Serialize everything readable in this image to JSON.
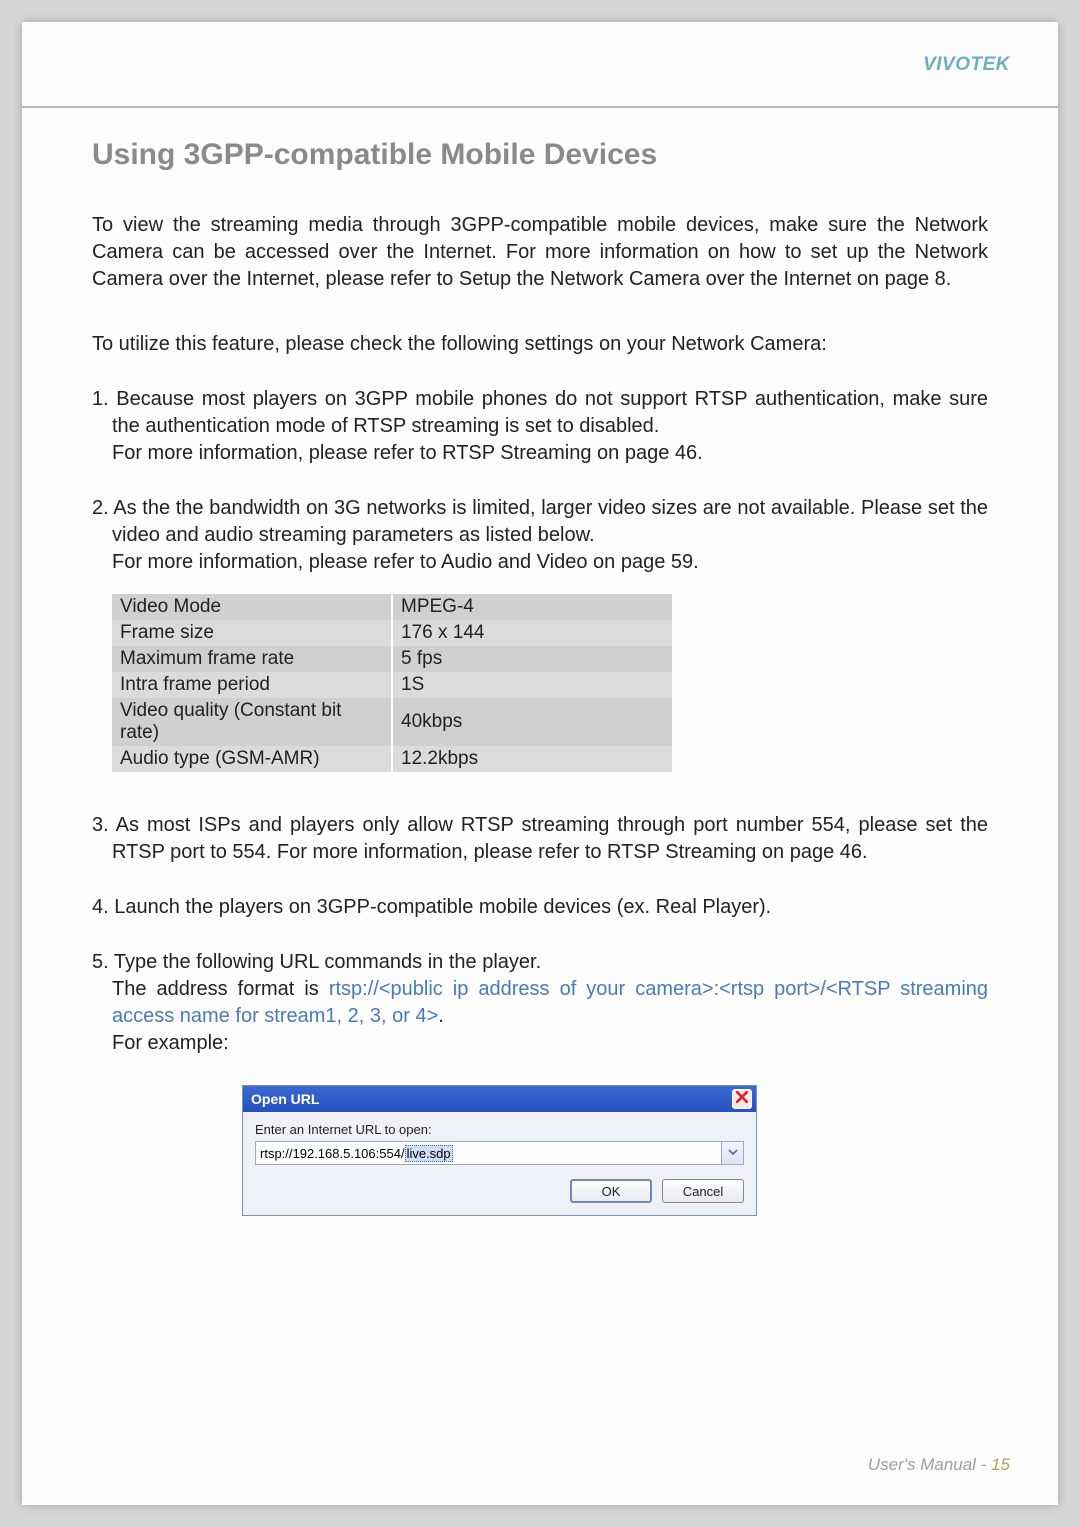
{
  "brand": "VIVOTEK",
  "heading": "Using 3GPP-compatible Mobile Devices",
  "intro": "To view the streaming media through 3GPP-compatible mobile devices, make sure the Network Camera can be accessed over the Internet. For more information on how to set up the Network Camera over the Internet, please refer to Setup the Network Camera over the Internet on page 8.",
  "intro2": "To utilize this feature, please check the following settings on your Network Camera:",
  "item1_a": "1. Because most players on 3GPP mobile phones do not support RTSP authentication, make sure the authentication mode of RTSP streaming is set to disabled.",
  "item1_b": "For more information, please refer to RTSP Streaming on page 46.",
  "item2_a": "2. As the the bandwidth on 3G networks is limited, larger video sizes are not available. Please set the video and audio streaming parameters as listed below.",
  "item2_b": "For more information, please refer to Audio and Video on page 59.",
  "table": [
    {
      "k": "Video Mode",
      "v": "MPEG-4"
    },
    {
      "k": "Frame size",
      "v": "176 x 144"
    },
    {
      "k": "Maximum frame rate",
      "v": "5 fps"
    },
    {
      "k": "Intra frame period",
      "v": "1S"
    },
    {
      "k": "Video quality (Constant bit rate)",
      "v": "40kbps"
    },
    {
      "k": "Audio type (GSM-AMR)",
      "v": "12.2kbps"
    }
  ],
  "item3": "3. As most ISPs and players only allow RTSP streaming through port number 554, please set the RTSP port to 554. For more information, please refer to RTSP Streaming on page 46.",
  "item4": "4. Launch the players on 3GPP-compatible mobile devices (ex. Real Player).",
  "item5_a": "5. Type the following URL commands in the player.",
  "item5_b_pre": "The address format is ",
  "item5_b_url": "rtsp://<public ip address of your camera>:<rtsp port>/<RTSP streaming access name for stream1, 2, 3, or 4>",
  "item5_b_post": ".",
  "item5_c": "For example:",
  "dialog": {
    "title": "Open URL",
    "label": "Enter an Internet URL to open:",
    "url_plain": "rtsp://192.168.5.106:554/",
    "url_hl": "live.sdp",
    "ok": "OK",
    "cancel": "Cancel"
  },
  "footer_label": "User's Manual - ",
  "footer_page": "15"
}
